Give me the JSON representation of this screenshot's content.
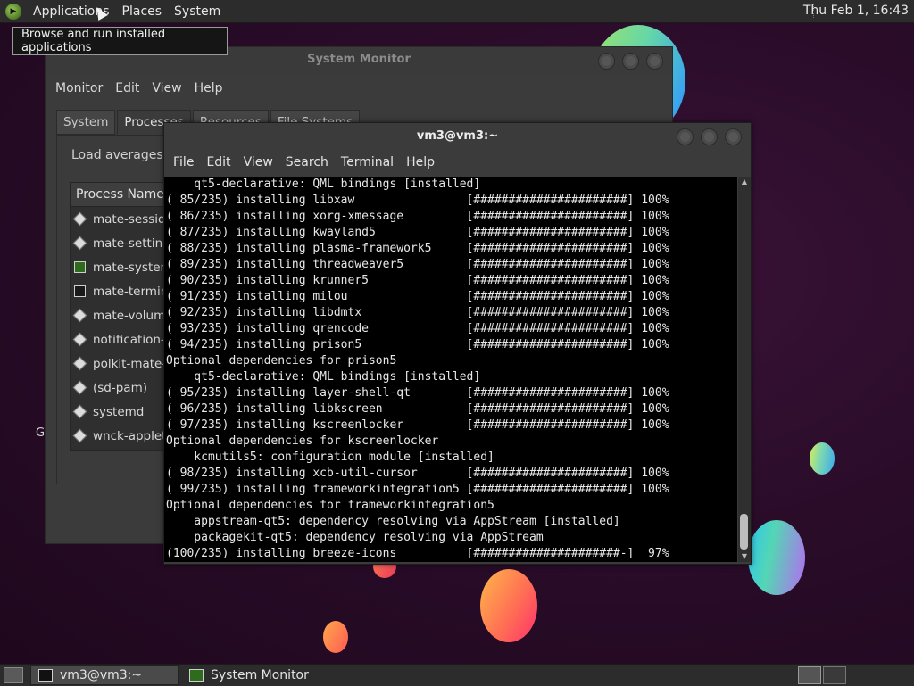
{
  "top_panel": {
    "menus": [
      "Applications",
      "Places",
      "System"
    ],
    "clock": "Thu Feb  1, 16:43"
  },
  "tooltip": "Browse and run installed applications",
  "desktop_label": "G",
  "system_monitor": {
    "title": "System Monitor",
    "menus": [
      "Monitor",
      "Edit",
      "View",
      "Help"
    ],
    "tabs": [
      "System",
      "Processes",
      "Resources",
      "File Systems"
    ],
    "active_tab": "Processes",
    "load_text": "Load averages fo",
    "column_header": "Process Name",
    "processes": [
      {
        "name": "mate-session",
        "icon": "diamond-icon"
      },
      {
        "name": "mate-setting",
        "icon": "diamond-icon"
      },
      {
        "name": "mate-system",
        "icon": "monitor-icon"
      },
      {
        "name": "mate-termina",
        "icon": "terminal-icon"
      },
      {
        "name": "mate-volume",
        "icon": "diamond-icon"
      },
      {
        "name": "notification-a",
        "icon": "diamond-icon"
      },
      {
        "name": "polkit-mate-a",
        "icon": "diamond-icon"
      },
      {
        "name": "(sd-pam)",
        "icon": "diamond-icon"
      },
      {
        "name": "systemd",
        "icon": "diamond-icon"
      },
      {
        "name": "wnck-applet",
        "icon": "diamond-icon"
      }
    ]
  },
  "terminal": {
    "title": "vm3@vm3:~",
    "menus": [
      "File",
      "Edit",
      "View",
      "Search",
      "Terminal",
      "Help"
    ],
    "lines": [
      "    qt5-declarative: QML bindings [installed]",
      "( 85/235) installing libxaw                [######################] 100%",
      "( 86/235) installing xorg-xmessage         [######################] 100%",
      "( 87/235) installing kwayland5             [######################] 100%",
      "( 88/235) installing plasma-framework5     [######################] 100%",
      "( 89/235) installing threadweaver5         [######################] 100%",
      "( 90/235) installing krunner5              [######################] 100%",
      "( 91/235) installing milou                 [######################] 100%",
      "( 92/235) installing libdmtx               [######################] 100%",
      "( 93/235) installing qrencode              [######################] 100%",
      "( 94/235) installing prison5               [######################] 100%",
      "Optional dependencies for prison5",
      "    qt5-declarative: QML bindings [installed]",
      "( 95/235) installing layer-shell-qt        [######################] 100%",
      "( 96/235) installing libkscreen            [######################] 100%",
      "( 97/235) installing kscreenlocker         [######################] 100%",
      "Optional dependencies for kscreenlocker",
      "    kcmutils5: configuration module [installed]",
      "( 98/235) installing xcb-util-cursor       [######################] 100%",
      "( 99/235) installing frameworkintegration5 [######################] 100%",
      "Optional dependencies for frameworkintegration5",
      "    appstream-qt5: dependency resolving via AppStream [installed]",
      "    packagekit-qt5: dependency resolving via AppStream",
      "(100/235) installing breeze-icons          [#####################-]  97%"
    ]
  },
  "taskbar": {
    "tasks": [
      {
        "label": "vm3@vm3:~",
        "icon": "terminal-icon",
        "active": true
      },
      {
        "label": "System Monitor",
        "icon": "monitor-icon",
        "active": false
      }
    ]
  }
}
